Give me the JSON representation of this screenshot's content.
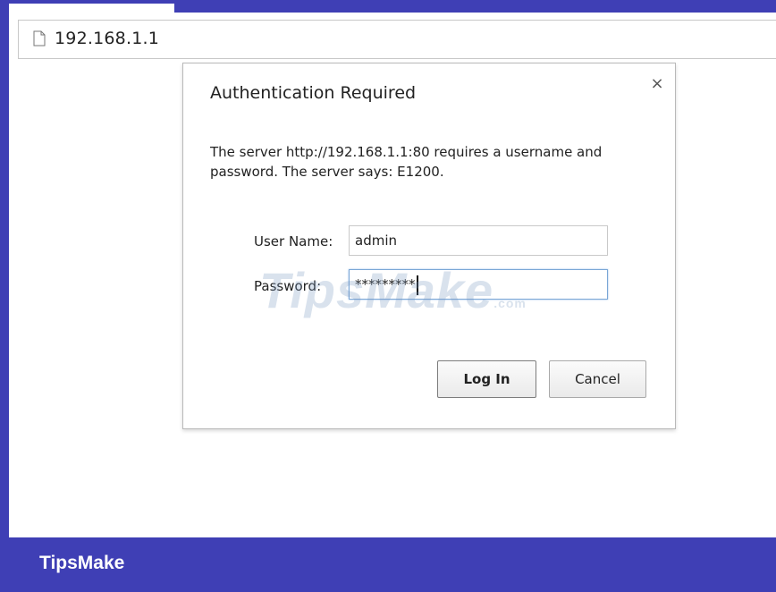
{
  "address_bar": {
    "icon": "page-icon",
    "url": "192.168.1.1"
  },
  "dialog": {
    "title": "Authentication Required",
    "close_icon": "close-icon",
    "close_glyph": "×",
    "message": "The server http://192.168.1.1:80 requires a username and password. The server says: E1200.",
    "username_label": "User Name:",
    "username_value": "admin",
    "password_label": "Password:",
    "password_value": "*********",
    "login_label": "Log In",
    "cancel_label": "Cancel"
  },
  "watermark": {
    "text": "TipsMake",
    "suffix": ".com"
  },
  "footer": {
    "brand": "TipsMake"
  },
  "colors": {
    "frame": "#3f3fb5",
    "focus_border": "#7aa6d6"
  }
}
